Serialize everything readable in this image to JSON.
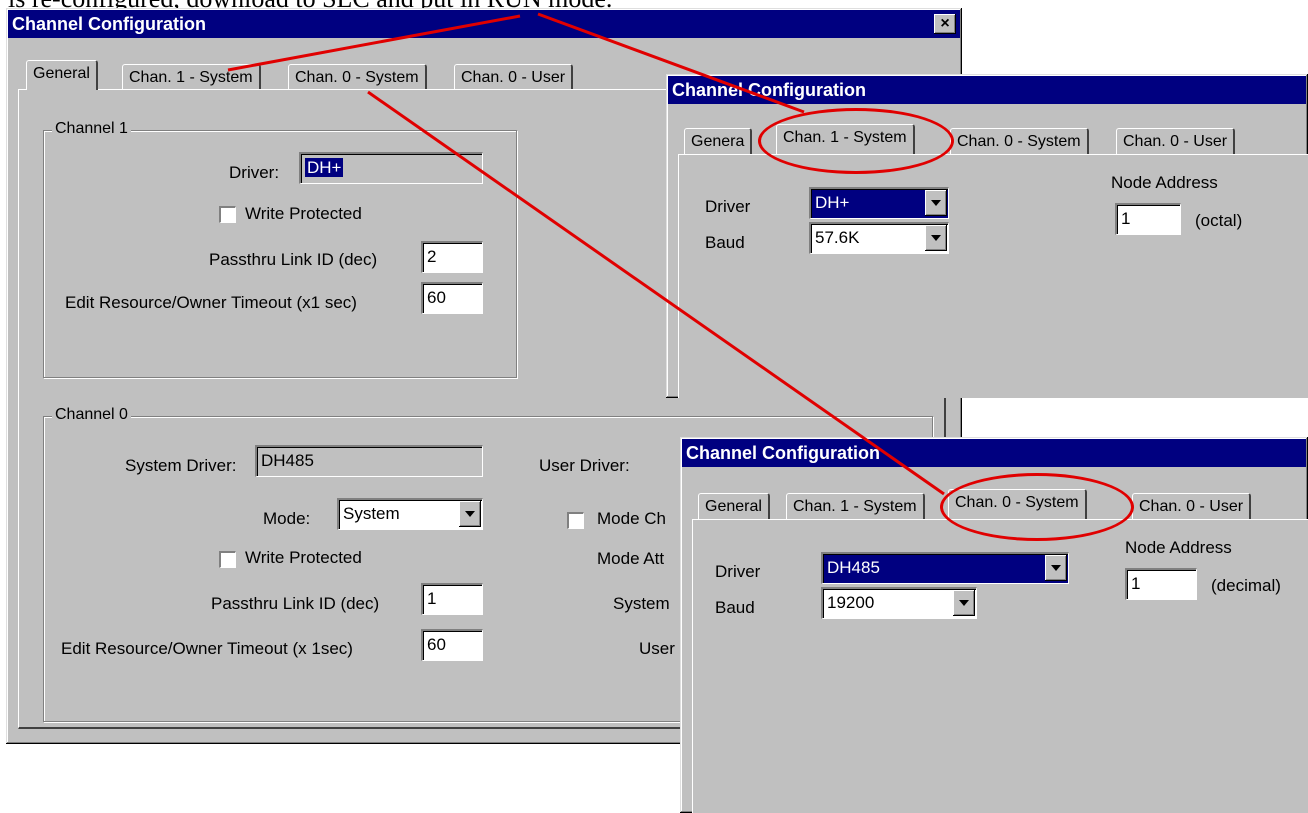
{
  "caption": "is re-configured, download to SLC and put in RUN mode.",
  "close_glyph": "×",
  "main": {
    "title": "Channel Configuration",
    "tabs": [
      "General",
      "Chan. 1 - System",
      "Chan. 0 - System",
      "Chan. 0 - User"
    ],
    "channel1": {
      "group_title": "Channel 1",
      "driver_label": "Driver:",
      "driver_value": "DH+",
      "write_protected_label": "Write Protected",
      "passthru_label": "Passthru Link ID (dec)",
      "passthru_value": "2",
      "timeout_label": "Edit Resource/Owner Timeout (x1 sec)",
      "timeout_value": "60"
    },
    "channel0": {
      "group_title": "Channel 0",
      "system_driver_label": "System Driver:",
      "system_driver_value": "DH485",
      "user_driver_label": "User Driver:",
      "mode_label": "Mode:",
      "mode_value": "System",
      "mode_changes_label": "Mode Ch",
      "write_protected_label": "Write Protected",
      "mode_attention_label": "Mode Att",
      "passthru_label": "Passthru Link ID (dec)",
      "passthru_value": "1",
      "system_label": "System",
      "timeout_label": "Edit Resource/Owner Timeout (x 1sec)",
      "timeout_value": "60",
      "user_label": "User"
    }
  },
  "chan1_dialog": {
    "title": "Channel Configuration",
    "tabs": [
      "Genera",
      "Chan. 1 - System",
      "Chan. 0 - System",
      "Chan. 0 - User"
    ],
    "driver_label": "Driver",
    "driver_value": "DH+",
    "baud_label": "Baud",
    "baud_value": "57.6K",
    "node_address_label": "Node Address",
    "node_address_value": "1",
    "node_address_unit": "(octal)"
  },
  "chan0_dialog": {
    "title": "Channel Configuration",
    "tabs": [
      "General",
      "Chan. 1 - System",
      "Chan. 0 - System",
      "Chan. 0 - User"
    ],
    "driver_label": "Driver",
    "driver_value": "DH485",
    "baud_label": "Baud",
    "baud_value": "19200",
    "node_address_label": "Node Address",
    "node_address_value": "1",
    "node_address_unit": "(decimal)"
  },
  "colors": {
    "title_bar": "#000080",
    "dialog_bg": "#c0c0c0",
    "annotation": "#e00000"
  }
}
